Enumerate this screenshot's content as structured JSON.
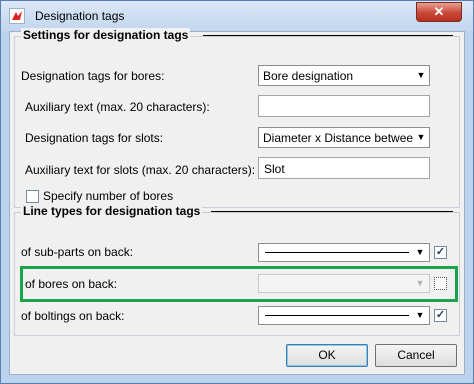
{
  "window": {
    "title": "Designation tags",
    "close_glyph": "✕"
  },
  "group_settings": {
    "title": "Settings for designation tags",
    "bores_label": "Designation tags for bores:",
    "bores_value": "Bore designation",
    "aux_label": "Auxiliary text (max. 20 characters):",
    "aux_value": "",
    "slots_label": "Designation tags for slots:",
    "slots_value": "Diameter x Distance betweer",
    "aux_slots_label": "Auxiliary text for slots (max. 20 characters):",
    "aux_slots_value": "Slot",
    "specify_label": "Specify number of bores",
    "specify_checked": false
  },
  "group_lines": {
    "title": "Line types for designation tags",
    "rows": [
      {
        "label": "of sub-parts on back:",
        "checked": true,
        "enabled": true
      },
      {
        "label": "of bores on back:",
        "checked": false,
        "enabled": false
      },
      {
        "label": "of boltings on back:",
        "checked": true,
        "enabled": true
      }
    ]
  },
  "buttons": {
    "ok": "OK",
    "cancel": "Cancel"
  },
  "icons": {
    "check": "✓",
    "dropdown": "▼"
  },
  "colors": {
    "highlight": "#19a34a",
    "title_bar": "#c2d6ef"
  }
}
